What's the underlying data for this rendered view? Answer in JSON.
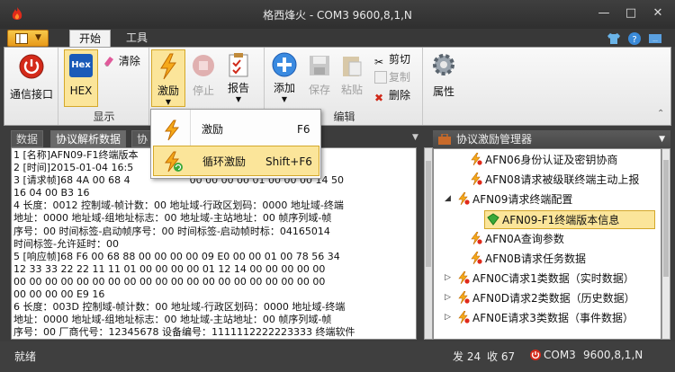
{
  "window": {
    "title": "格西烽火 - COM3  9600,8,1,N"
  },
  "tabs": [
    {
      "label": "开始"
    },
    {
      "label": "工具"
    }
  ],
  "ribbon": {
    "groups": {
      "display": "显示",
      "edit": "编辑"
    },
    "comm": {
      "label": "通信接口"
    },
    "hex": {
      "badge": "Hex",
      "label": "HEX"
    },
    "clear": {
      "label": "清除"
    },
    "excite": {
      "label": "激励"
    },
    "stop": {
      "label": "停止"
    },
    "report": {
      "label": "报告"
    },
    "add": {
      "label": "添加"
    },
    "save": {
      "label": "保存"
    },
    "paste": {
      "label": "粘贴"
    },
    "cut": {
      "label": "剪切"
    },
    "copy": {
      "label": "复制"
    },
    "delete": {
      "label": "删除"
    },
    "props": {
      "label": "属性"
    }
  },
  "dropdown": {
    "items": [
      {
        "label": "激励",
        "shortcut": "F6"
      },
      {
        "label": "循环激励",
        "shortcut": "Shift+F6"
      }
    ]
  },
  "left_panel": {
    "tabs": [
      {
        "label": "数据"
      },
      {
        "label": "协议解析数据"
      },
      {
        "label": "协"
      }
    ],
    "lines": [
      "1 [名称]AFN09-F1终端版本",
      "2 [时间]2015-01-04 16:5",
      "3 [请求帧]68 4A 00 68 4",
      "  16 04 00 B3 16",
      "4  长度：0012  控制域-帧计数：00   地址域-行政区划码：0000   地址域-终端",
      "  地址：0000   地址域-组地址标志：00  地址域-主站地址：00   帧序列域-帧",
      "  序号：00   时间标签-启动帧序号：00   时间标签-启动帧时标：04165014",
      "  时间标签-允许延时：00",
      "5 [响应帧]68 F6 00 68 88 00 00 00 00 09 E0 00 00 01 00 78 56 34",
      "  12 33 33 22 22 11 11 01 00 00 00 00 01 12 14 00 00 00 00 00",
      "  00 00 00 00 00 00 00 00 00 00 00 00 00 00 00 00 00 00 00 00",
      "  00 00 00 00 E9 16",
      "6  长度：003D  控制域-帧计数：00   地址域-行政区划码：0000   地址域-终端",
      "  地址：0000   地址域-组地址标志：00  地址域-主站地址：00   帧序列域-帧",
      "  序号：00   厂商代号：12345678   设备编号：1111112222223333   终端软件"
    ],
    "line3_tail": "00 00 00 00 01 00 00 00 14 50"
  },
  "right_panel": {
    "title": "协议激励管理器",
    "nodes": [
      {
        "label": "AFN06身份认证及密钥协商"
      },
      {
        "label": "AFN08请求被级联终端主动上报"
      },
      {
        "label": "AFN09请求终端配置"
      },
      {
        "label": "AFN09-F1终端版本信息"
      },
      {
        "label": "AFN0A查询参数"
      },
      {
        "label": "AFN0B请求任务数据"
      },
      {
        "label": "AFN0C请求1类数据（实时数据）"
      },
      {
        "label": "AFN0D请求2类数据（历史数据）"
      },
      {
        "label": "AFN0E请求3类数据（事件数据）"
      }
    ]
  },
  "status": {
    "ready": "就绪",
    "sent": "发 24",
    "recv": "收 67",
    "port": "COM3",
    "config": "9600,8,1,N"
  },
  "colors": {
    "accent": "#f7c84a",
    "highlight": "#fbe59a",
    "dark": "#3c3c3c"
  }
}
